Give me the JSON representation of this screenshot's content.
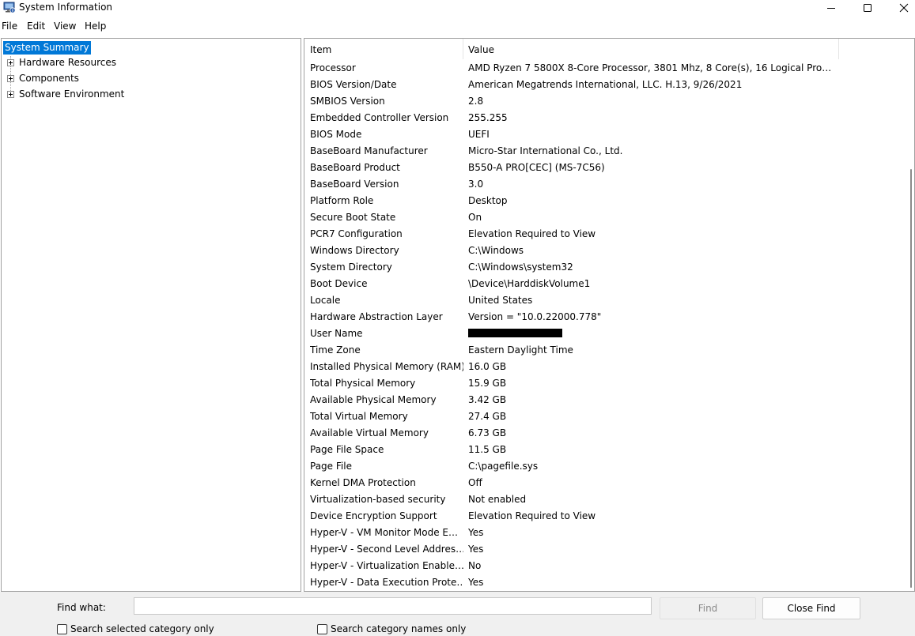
{
  "window": {
    "title": "System Information",
    "app_icon": "system-information-icon",
    "controls": [
      "minimize-icon",
      "maximize-icon",
      "close-icon"
    ]
  },
  "menu": [
    "File",
    "Edit",
    "View",
    "Help"
  ],
  "tree": {
    "selected": "System Summary",
    "nodes": [
      "Hardware Resources",
      "Components",
      "Software Environment"
    ],
    "expander_icon": "plus-expander-icon"
  },
  "list": {
    "columns": [
      "Item",
      "Value"
    ],
    "rows": [
      {
        "item": "Processor",
        "value": "AMD Ryzen 7 5800X 8-Core Processor, 3801 Mhz, 8 Core(s), 16 Logical Proce…"
      },
      {
        "item": "BIOS Version/Date",
        "value": "American Megatrends International, LLC. H.13, 9/26/2021"
      },
      {
        "item": "SMBIOS Version",
        "value": "2.8"
      },
      {
        "item": "Embedded Controller Version",
        "value": "255.255"
      },
      {
        "item": "BIOS Mode",
        "value": "UEFI"
      },
      {
        "item": "BaseBoard Manufacturer",
        "value": "Micro-Star International Co., Ltd."
      },
      {
        "item": "BaseBoard Product",
        "value": "B550-A PRO[CEC] (MS-7C56)"
      },
      {
        "item": "BaseBoard Version",
        "value": "3.0"
      },
      {
        "item": "Platform Role",
        "value": "Desktop"
      },
      {
        "item": "Secure Boot State",
        "value": "On"
      },
      {
        "item": "PCR7 Configuration",
        "value": "Elevation Required to View"
      },
      {
        "item": "Windows Directory",
        "value": "C:\\Windows"
      },
      {
        "item": "System Directory",
        "value": "C:\\Windows\\system32"
      },
      {
        "item": "Boot Device",
        "value": "\\Device\\HarddiskVolume1"
      },
      {
        "item": "Locale",
        "value": "United States"
      },
      {
        "item": "Hardware Abstraction Layer",
        "value": "Version = \"10.0.22000.778\""
      },
      {
        "item": "User Name",
        "value": "",
        "redacted": true
      },
      {
        "item": "Time Zone",
        "value": "Eastern Daylight Time"
      },
      {
        "item": "Installed Physical Memory (RAM)",
        "value": "16.0 GB"
      },
      {
        "item": "Total Physical Memory",
        "value": "15.9 GB"
      },
      {
        "item": "Available Physical Memory",
        "value": "3.42 GB"
      },
      {
        "item": "Total Virtual Memory",
        "value": "27.4 GB"
      },
      {
        "item": "Available Virtual Memory",
        "value": "6.73 GB"
      },
      {
        "item": "Page File Space",
        "value": "11.5 GB"
      },
      {
        "item": "Page File",
        "value": "C:\\pagefile.sys"
      },
      {
        "item": "Kernel DMA Protection",
        "value": "Off"
      },
      {
        "item": "Virtualization-based security",
        "value": "Not enabled"
      },
      {
        "item": "Device Encryption Support",
        "value": "Elevation Required to View"
      },
      {
        "item": "Hyper-V - VM Monitor Mode E…",
        "value": "Yes"
      },
      {
        "item": "Hyper-V - Second Level Addres…",
        "value": "Yes"
      },
      {
        "item": "Hyper-V - Virtualization Enable…",
        "value": "No"
      },
      {
        "item": "Hyper-V - Data Execution Prote…",
        "value": "Yes"
      }
    ]
  },
  "find": {
    "label": "Find what:",
    "input_value": "",
    "find_button": "Find",
    "close_find_button": "Close Find",
    "checkbox_selected_category": "Search selected category only",
    "checkbox_category_names": "Search category names only"
  },
  "colors": {
    "selection": "#0078d7",
    "border": "#a0a0a0",
    "findbar_bg": "#f0f0f0"
  }
}
